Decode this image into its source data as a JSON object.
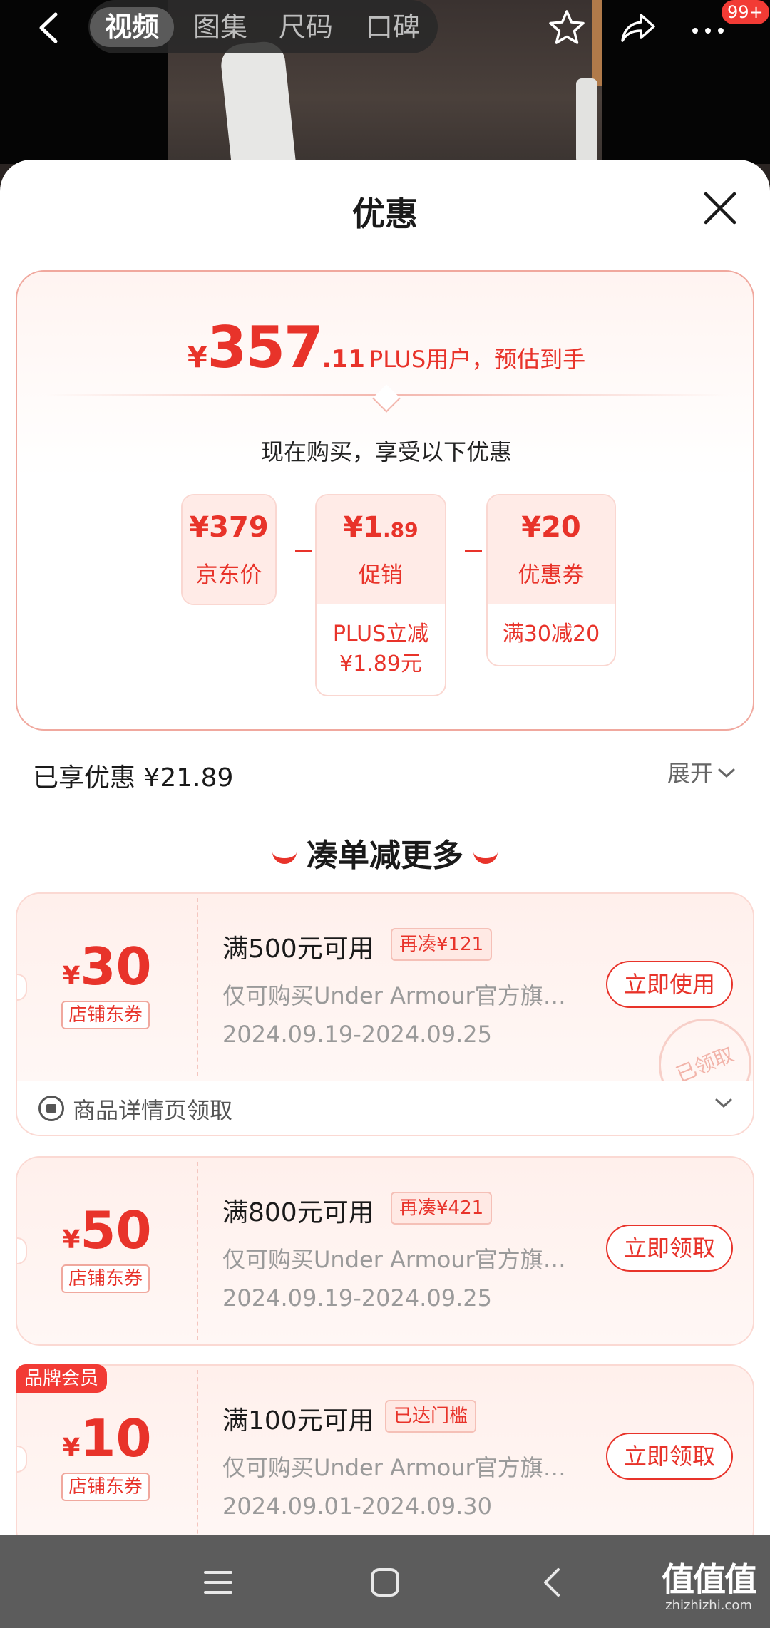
{
  "header": {
    "tabs": [
      "视频",
      "图集",
      "尺码",
      "口碑"
    ],
    "active_tab": 0,
    "badge": "99+"
  },
  "sheet": {
    "title": "优惠",
    "summary": {
      "yen": "¥",
      "price_int": "357",
      "price_dec": ".11",
      "price_note": "PLUS用户，预估到手",
      "buy_now": "现在购买，享受以下优惠",
      "items": [
        {
          "value_big": "¥379",
          "value_small": "",
          "label": "京东价",
          "detail": ""
        },
        {
          "value_big": "¥1",
          "value_small": ".89",
          "label": "促销",
          "detail_line1": "PLUS立减",
          "detail_line2": "¥1.89元"
        },
        {
          "value_big": "¥20",
          "value_small": "",
          "label": "优惠券",
          "detail_line1": "满30减20",
          "detail_line2": ""
        }
      ]
    },
    "saved_text": "已享优惠 ¥21.89",
    "expand_label": "展开",
    "more_title": "凑单减更多",
    "coupons": [
      {
        "yen": "¥",
        "amount": "30",
        "store_tag": "店铺东券",
        "title": "满500元可用",
        "tag": "再凑¥121",
        "desc": "仅可购买Under Armour官方旗…",
        "date": "2024.09.19-2024.09.25",
        "button": "立即使用",
        "stamp": "已领取",
        "footer": "商品详情页领取"
      },
      {
        "yen": "¥",
        "amount": "50",
        "store_tag": "店铺东券",
        "title": "满800元可用",
        "tag": "再凑¥421",
        "desc": "仅可购买Under Armour官方旗…",
        "date": "2024.09.19-2024.09.25",
        "button": "立即领取"
      },
      {
        "yen": "¥",
        "amount": "10",
        "store_tag": "店铺东券",
        "title": "满100元可用",
        "tag": "已达门槛",
        "desc": "仅可购买Under Armour官方旗…",
        "date": "2024.09.01-2024.09.30",
        "button": "立即领取",
        "brand_badge": "品牌会员"
      }
    ]
  },
  "watermark": {
    "big": "值值值",
    "small": "zhizhizhi.com"
  },
  "colors": {
    "accent": "#e8332a",
    "border": "#f0a89e",
    "card_bg": "#fff0ec"
  }
}
